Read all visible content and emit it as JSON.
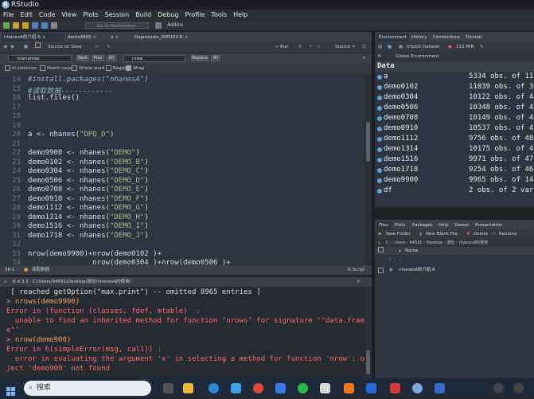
{
  "window": {
    "title": "RStudio"
  },
  "menu": [
    "File",
    "Edit",
    "Code",
    "View",
    "Plots",
    "Session",
    "Build",
    "Debug",
    "Profile",
    "Tools",
    "Help"
  ],
  "toolbar": {
    "goto_placeholder": "Go to file/function",
    "addins": "Addins"
  },
  "source": {
    "tabs": [
      "nhanesA的介绍.R",
      "demo9900",
      "a",
      "Depression_DP0102.R"
    ],
    "toolbar": {
      "source_on_save": "Source on Save",
      "run": "Run",
      "source": "Source"
    },
    "find": {
      "find_value": "rownames",
      "next": "Next",
      "prev": "Prev",
      "all": "All",
      "replace_value": "nrow",
      "replace": "Replace",
      "replace_all": "All"
    },
    "options": [
      "In selection",
      "Match case",
      "Whole word",
      "Regex",
      "Wrap"
    ],
    "lines": [
      {
        "n": "14",
        "text": "#install.packages(\"nhanesA\")"
      },
      {
        "n": "15",
        "text": "#读取数据------------"
      },
      {
        "n": "16",
        "text": "list.files()"
      },
      {
        "n": "17",
        "text": ""
      },
      {
        "n": "18",
        "text": ""
      },
      {
        "n": "19",
        "text": ""
      },
      {
        "n": "20",
        "text": "a <- nhanes(\"DPQ_D\")"
      },
      {
        "n": "21",
        "text": ""
      },
      {
        "n": "22",
        "text": "demo9900 <- nhanes(\"DEMO\")"
      },
      {
        "n": "23",
        "text": "demo0102 <- nhanes(\"DEMO_B\")"
      },
      {
        "n": "24",
        "text": "demo0304 <- nhanes(\"DEMO_C\")"
      },
      {
        "n": "25",
        "text": "demo0506 <- nhanes(\"DEMO_D\")"
      },
      {
        "n": "26",
        "text": "demo0708 <- nhanes(\"DEMO_E\")"
      },
      {
        "n": "27",
        "text": "demo0910 <- nhanes(\"DEMO_F\")"
      },
      {
        "n": "28",
        "text": "demo1112 <- nhanes(\"DEMO_G\")"
      },
      {
        "n": "29",
        "text": "demo1314 <- nhanes(\"DEMO_H\")"
      },
      {
        "n": "30",
        "text": "demo1516 <- nhanes(\"DEMO_I\")"
      },
      {
        "n": "31",
        "text": "demo1718 <- nhanes(\"DEMO_J\")"
      },
      {
        "n": "32",
        "text": ""
      },
      {
        "n": "33",
        "text": "nrow(demo9900)+nrow(demo0102 )+"
      },
      {
        "n": "34",
        "text": "               nrow(demo0304 )+nrow(demo0506 )+"
      }
    ],
    "status_position": "38:1",
    "status_section": "读取数据",
    "status_type": "R Script"
  },
  "console": {
    "header": "R 4.3.3 · C:/Users/94591/Desktop/游玩/nhanesA的使用/",
    "lines": [
      {
        "t": "out",
        "text": " [ reached getOption(\"max.print\") -- omitted 8965 entries ]"
      },
      {
        "t": "prompt",
        "text": "> nrows(demo9900)"
      },
      {
        "t": "err",
        "text": "Error in (function (classes, fdef, mtable)  :"
      },
      {
        "t": "err",
        "text": "  unable to find an inherited method for function ‘nrows’ for signature ‘\"data.fram"
      },
      {
        "t": "err",
        "text": "e\"’"
      },
      {
        "t": "prompt",
        "text": "> nrow(demo900)"
      },
      {
        "t": "err",
        "text": "Error in h(simpleError(msg, call)) :"
      },
      {
        "t": "err",
        "text": "  error in evaluating the argument 'x' in selecting a method for function 'nrow': ob"
      },
      {
        "t": "err",
        "text": "ject 'demo900' not found"
      }
    ]
  },
  "environment": {
    "tabs": [
      "Environment",
      "History",
      "Connections",
      "Tutorial"
    ],
    "import": "Import Dataset",
    "memory": "212 MiB",
    "scope": "Global Environment",
    "r_label": "R",
    "section": "Data",
    "rows": [
      {
        "name": "a",
        "value": "5334 obs. of 11"
      },
      {
        "name": "demo0102",
        "value": "11039 obs. of 37"
      },
      {
        "name": "demo0304",
        "value": "10122 obs. of 44"
      },
      {
        "name": "demo0506",
        "value": "10348 obs. of 43"
      },
      {
        "name": "demo0708",
        "value": "10149 obs. of 43"
      },
      {
        "name": "demo0910",
        "value": "10537 obs. of 43"
      },
      {
        "name": "demo1112",
        "value": "9756 obs. of 48"
      },
      {
        "name": "demo1314",
        "value": "10175 obs. of 47"
      },
      {
        "name": "demo1516",
        "value": "9971 obs. of 47"
      },
      {
        "name": "demo1718",
        "value": "9254 obs. of 46"
      },
      {
        "name": "demo9900",
        "value": "9965 obs. of 144"
      },
      {
        "name": "df",
        "value": "2 obs. of 2 vari"
      }
    ]
  },
  "files": {
    "tabs": [
      "Files",
      "Plots",
      "Packages",
      "Help",
      "Viewer",
      "Presentation"
    ],
    "new_folder": "New Folder",
    "new_blank": "New Blank File",
    "delete": "Delete",
    "rename": "Rename",
    "breadcrumb": "C: › Users › 94591 › Desktop › 游玩 › nhanesA的使用",
    "name_col": "Name",
    "up": "..",
    "items": [
      "nhanesA的介绍.R"
    ]
  },
  "taskbar": {
    "search": "搜索"
  }
}
